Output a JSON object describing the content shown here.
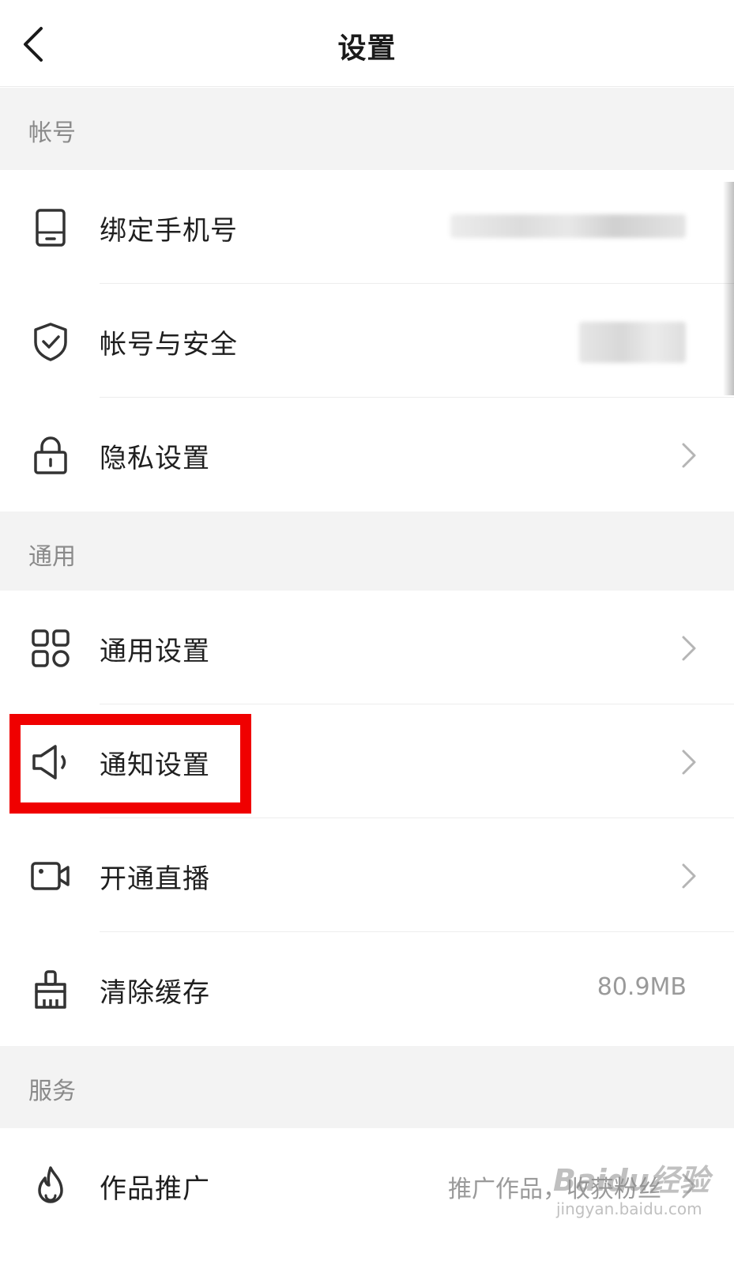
{
  "header": {
    "title": "设置"
  },
  "sections": [
    {
      "header": "帐号",
      "items": [
        {
          "label": "绑定手机号",
          "icon": "phone-icon",
          "value": "",
          "chevron": false
        },
        {
          "label": "帐号与安全",
          "icon": "shield-check-icon",
          "value": "",
          "chevron": false
        },
        {
          "label": "隐私设置",
          "icon": "lock-icon",
          "value": "",
          "chevron": true
        }
      ]
    },
    {
      "header": "通用",
      "items": [
        {
          "label": "通用设置",
          "icon": "grid-icon",
          "value": "",
          "chevron": true
        },
        {
          "label": "通知设置",
          "icon": "speaker-icon",
          "value": "",
          "chevron": true,
          "highlighted": true
        },
        {
          "label": "开通直播",
          "icon": "video-camera-icon",
          "value": "",
          "chevron": true
        },
        {
          "label": "清除缓存",
          "icon": "broom-icon",
          "value": "80.9MB",
          "chevron": false
        }
      ]
    },
    {
      "header": "服务",
      "items": [
        {
          "label": "作品推广",
          "icon": "flame-icon",
          "value": "推广作品，收获粉丝",
          "chevron": true
        }
      ]
    }
  ],
  "colors": {
    "highlight": "#f00000",
    "section_bg": "#f3f3f3",
    "muted_text": "#9a9a9a"
  },
  "watermark": {
    "main": "Baidu经验",
    "sub": "jingyan.baidu.com"
  }
}
